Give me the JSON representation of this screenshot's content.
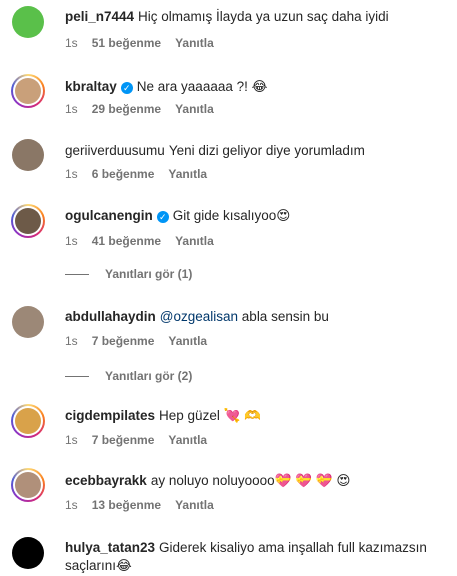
{
  "comments": [
    {
      "username": "peli_n7444",
      "verified": false,
      "text": "Hiç olmamış İlayda ya uzun saç daha iyidi",
      "time": "1s",
      "likes": "51 beğenme",
      "reply": "Yanıtla",
      "avatar_color": "#5ac04a"
    },
    {
      "username": "kbraltay",
      "verified": true,
      "text": "Ne ara yaaaaaa ?! 😂",
      "time": "1s",
      "likes": "29 beğenme",
      "reply": "Yanıtla",
      "avatar_color": "#c9a07a"
    },
    {
      "username": "geriiverduusumu",
      "verified": false,
      "text": "Yeni dizi geliyor diye yorumladım",
      "time": "1s",
      "likes": "6 beğenme",
      "reply": "Yanıtla",
      "avatar_color": "#8a7766"
    },
    {
      "username": "ogulcanengin",
      "verified": true,
      "text": "Git gide kısalıyoo😍",
      "time": "1s",
      "likes": "41 beğenme",
      "reply": "Yanıtla",
      "avatar_color": "#6d5a48",
      "view_replies": "Yanıtları gör (1)"
    },
    {
      "username": "abdullahaydin",
      "verified": false,
      "mention": "@ozgealisan",
      "text": "abla sensin bu",
      "time": "1s",
      "likes": "7 beğenme",
      "reply": "Yanıtla",
      "avatar_color": "#9c8877",
      "view_replies": "Yanıtları gör (2)"
    },
    {
      "username": "cigdempilates",
      "verified": false,
      "text": "Hep güzel 💘 🫶",
      "time": "1s",
      "likes": "7 beğenme",
      "reply": "Yanıtla",
      "avatar_color": "#d9a24a"
    },
    {
      "username": "ecebbayrakk",
      "verified": false,
      "text": "ay noluyo noluyoooo💝 💝 💝 😍",
      "time": "1s",
      "likes": "13 beğenme",
      "reply": "Yanıtla",
      "avatar_color": "#b0907a"
    },
    {
      "username": "hulya_tatan23",
      "verified": false,
      "text": "Giderek kisaliyo ama inşallah full kazımazsın saçlarını😂",
      "avatar_color": "#000000"
    }
  ]
}
